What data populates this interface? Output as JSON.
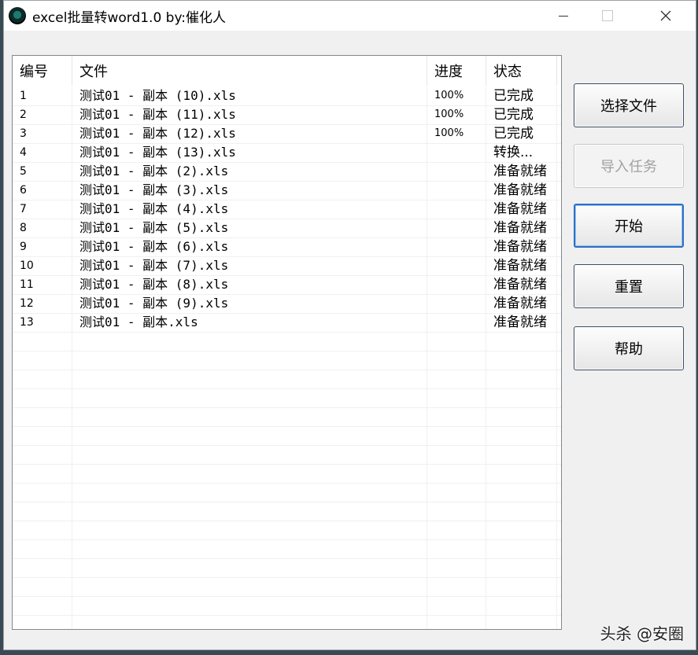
{
  "window": {
    "title": "excel批量转word1.0  by:催化人"
  },
  "table": {
    "headers": [
      "编号",
      "文件",
      "进度",
      "状态"
    ],
    "rows": [
      {
        "num": "1",
        "file": "测试01 - 副本 (10).xls",
        "progress": "100%",
        "status": "已完成"
      },
      {
        "num": "2",
        "file": "测试01 - 副本 (11).xls",
        "progress": "100%",
        "status": "已完成"
      },
      {
        "num": "3",
        "file": "测试01 - 副本 (12).xls",
        "progress": "100%",
        "status": "已完成"
      },
      {
        "num": "4",
        "file": "测试01 - 副本 (13).xls",
        "progress": "",
        "status": "转换..."
      },
      {
        "num": "5",
        "file": "测试01 - 副本 (2).xls",
        "progress": "",
        "status": "准备就绪"
      },
      {
        "num": "6",
        "file": "测试01 - 副本 (3).xls",
        "progress": "",
        "status": "准备就绪"
      },
      {
        "num": "7",
        "file": "测试01 - 副本 (4).xls",
        "progress": "",
        "status": "准备就绪"
      },
      {
        "num": "8",
        "file": "测试01 - 副本 (5).xls",
        "progress": "",
        "status": "准备就绪"
      },
      {
        "num": "9",
        "file": "测试01 - 副本 (6).xls",
        "progress": "",
        "status": "准备就绪"
      },
      {
        "num": "10",
        "file": "测试01 - 副本 (7).xls",
        "progress": "",
        "status": "准备就绪"
      },
      {
        "num": "11",
        "file": "测试01 - 副本 (8).xls",
        "progress": "",
        "status": "准备就绪"
      },
      {
        "num": "12",
        "file": "测试01 - 副本 (9).xls",
        "progress": "",
        "status": "准备就绪"
      },
      {
        "num": "13",
        "file": "测试01 - 副本.xls",
        "progress": "",
        "status": "准备就绪"
      }
    ]
  },
  "buttons": {
    "select_file": "选择文件",
    "import_task": "导入任务",
    "start": "开始",
    "reset": "重置",
    "help": "帮助"
  },
  "watermark": "头杀 @安圈"
}
